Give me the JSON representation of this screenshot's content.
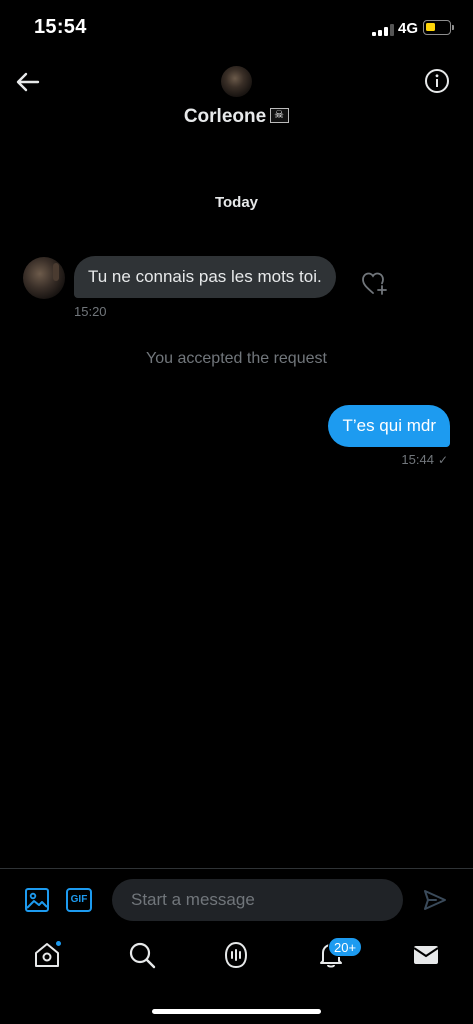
{
  "status_bar": {
    "time": "15:54",
    "network": "4G",
    "battery_level": 0.3,
    "battery_color": "#ffd60a"
  },
  "header": {
    "contact_name": "Corleone",
    "contact_emoji_icon": "pirate-flag-icon",
    "back_icon": "back-arrow-icon",
    "info_icon": "info-icon"
  },
  "conversation": {
    "date_separator": "Today",
    "messages": [
      {
        "direction": "incoming",
        "text": "Tu ne connais pas les mots toi.",
        "time": "15:20"
      },
      {
        "direction": "system",
        "text": "You accepted the request"
      },
      {
        "direction": "outgoing",
        "text": "T’es qui mdr",
        "time": "15:44",
        "status_icon": "sent-check-icon"
      }
    ]
  },
  "composer": {
    "placeholder": "Start a message",
    "gif_label": "GIF",
    "media_icon": "image-icon",
    "send_icon": "send-icon"
  },
  "tabbar": {
    "tabs": [
      "home-icon",
      "search-icon",
      "spaces-icon",
      "notifications-icon",
      "messages-icon"
    ],
    "notifications_badge": "20+"
  },
  "colors": {
    "accent": "#1d9bf0",
    "background": "#000000",
    "incoming_bubble": "#2f3336",
    "muted_text": "#71767b"
  }
}
